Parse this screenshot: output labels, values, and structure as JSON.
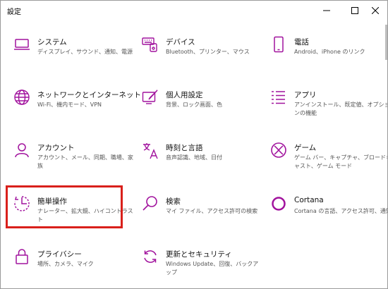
{
  "window": {
    "title": "設定",
    "controls": {
      "minimize": "minimize-icon",
      "maximize": "maximize-icon",
      "close": "close-icon"
    }
  },
  "accent_color": "#a1129d",
  "highlight_color": "#d9201b",
  "tiles": [
    {
      "name": "システム",
      "desc": "ディスプレイ、サウンド、通知、電源",
      "icon": "laptop-icon"
    },
    {
      "name": "デバイス",
      "desc": "Bluetooth、プリンター、マウス",
      "icon": "keyboard-icon"
    },
    {
      "name": "電話",
      "desc": "Android、iPhone のリンク",
      "icon": "phone-icon"
    },
    {
      "name": "ネットワークとインターネット",
      "desc": "Wi-Fi、機内モード、VPN",
      "icon": "globe-icon"
    },
    {
      "name": "個人用設定",
      "desc": "背景、ロック画面、色",
      "icon": "paint-icon"
    },
    {
      "name": "アプリ",
      "desc": "アンインストール、既定値、オプションの機能",
      "icon": "apps-list-icon"
    },
    {
      "name": "アカウント",
      "desc": "アカウント、メール、同期、職場、家族",
      "icon": "person-icon"
    },
    {
      "name": "時刻と言語",
      "desc": "音声認識、地域、日付",
      "icon": "time-language-icon"
    },
    {
      "name": "ゲーム",
      "desc": "ゲーム バー、キャプチャ、ブロードキャスト、ゲーム モード",
      "icon": "xbox-icon"
    },
    {
      "name": "簡単操作",
      "desc": "ナレーター、拡大鏡、ハイコントラスト",
      "icon": "ease-of-access-icon"
    },
    {
      "name": "検索",
      "desc": "マイ ファイル、アクセス許可の検索",
      "icon": "search-icon"
    },
    {
      "name": "Cortana",
      "desc": "Cortana の言語、アクセス許可、通知",
      "icon": "cortana-icon"
    },
    {
      "name": "プライバシー",
      "desc": "場所、カメラ、マイク",
      "icon": "lock-icon"
    },
    {
      "name": "更新とセキュリティ",
      "desc": "Windows Update、回復、バックアップ",
      "icon": "refresh-icon"
    }
  ]
}
